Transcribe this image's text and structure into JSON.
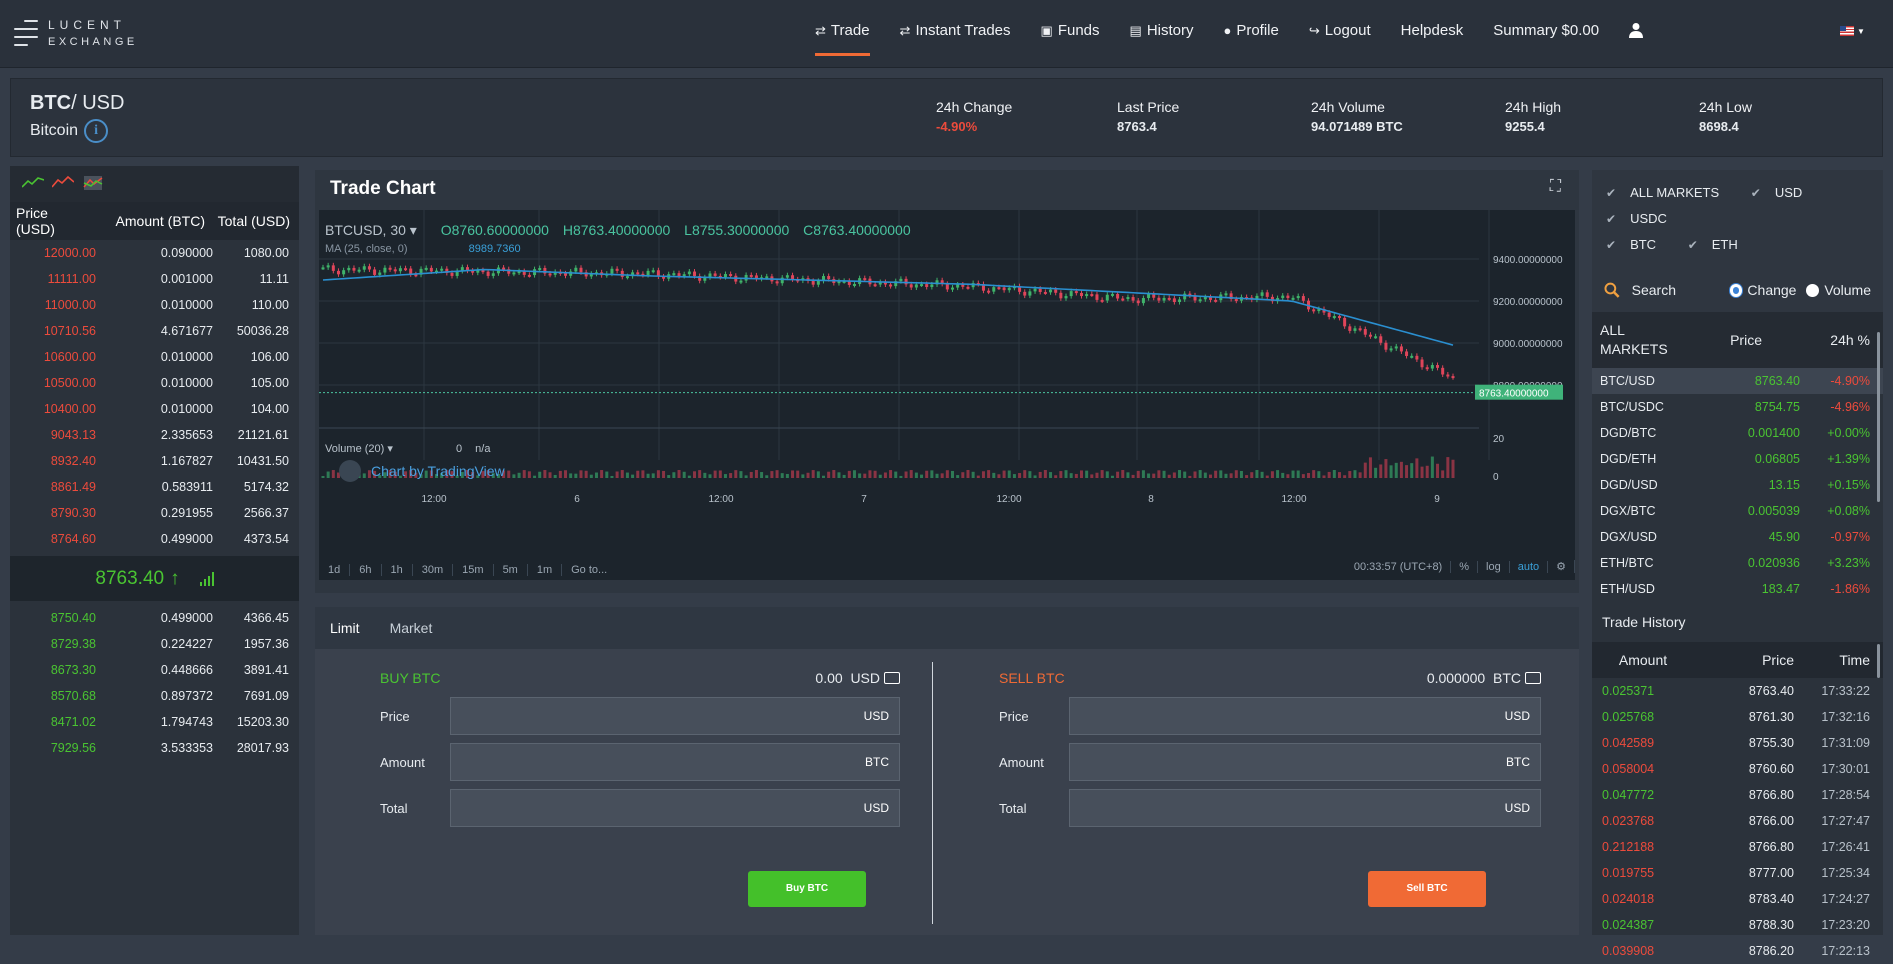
{
  "header": {
    "logo_line1": "LUCENT",
    "logo_line2": "EXCHANGE",
    "nav": [
      {
        "label": "Trade",
        "icon": "exchange-icon"
      },
      {
        "label": "Instant Trades",
        "icon": "exchange-icon"
      },
      {
        "label": "Funds",
        "icon": "money-icon"
      },
      {
        "label": "History",
        "icon": "book-icon"
      },
      {
        "label": "Profile",
        "icon": "user-icon"
      },
      {
        "label": "Logout",
        "icon": "logout-icon"
      },
      {
        "label": "Helpdesk"
      },
      {
        "label": "Summary $0.00"
      }
    ]
  },
  "ticker": {
    "base": "BTC",
    "quote": "/ USD",
    "name": "Bitcoin",
    "stats": [
      {
        "label": "24h Change",
        "value": "-4.90%"
      },
      {
        "label": "Last Price",
        "value": "8763.4"
      },
      {
        "label": "24h Volume",
        "value": "94.071489 BTC"
      },
      {
        "label": "24h High",
        "value": "9255.4"
      },
      {
        "label": "24h Low",
        "value": "8698.4"
      }
    ]
  },
  "orderbook": {
    "cols": [
      "Price (USD)",
      "Amount (BTC)",
      "Total (USD)"
    ],
    "asks": [
      [
        "12000.00",
        "0.090000",
        "1080.00"
      ],
      [
        "11111.00",
        "0.001000",
        "11.11"
      ],
      [
        "11000.00",
        "0.010000",
        "110.00"
      ],
      [
        "10710.56",
        "4.671677",
        "50036.28"
      ],
      [
        "10600.00",
        "0.010000",
        "106.00"
      ],
      [
        "10500.00",
        "0.010000",
        "105.00"
      ],
      [
        "10400.00",
        "0.010000",
        "104.00"
      ],
      [
        "9043.13",
        "2.335653",
        "21121.61"
      ],
      [
        "8932.40",
        "1.167827",
        "10431.50"
      ],
      [
        "8861.49",
        "0.583911",
        "5174.32"
      ],
      [
        "8790.30",
        "0.291955",
        "2566.37"
      ],
      [
        "8764.60",
        "0.499000",
        "4373.54"
      ]
    ],
    "last": "8763.40",
    "bids": [
      [
        "8750.40",
        "0.499000",
        "4366.45"
      ],
      [
        "8729.38",
        "0.224227",
        "1957.36"
      ],
      [
        "8673.30",
        "0.448666",
        "3891.41"
      ],
      [
        "8570.68",
        "0.897372",
        "7691.09"
      ],
      [
        "8471.02",
        "1.794743",
        "15203.30"
      ],
      [
        "7929.56",
        "3.533353",
        "28017.93"
      ]
    ]
  },
  "chart": {
    "title": "Trade Chart",
    "symbol": "BTCUSD, 30",
    "o": "O8760.60000000",
    "h": "H8763.40000000",
    "l": "L8755.30000000",
    "c": "C8763.40000000",
    "ma_label": "MA (25, close, 0)",
    "ma_value": "8989.7360",
    "volume_label": "Volume (20)",
    "volume_value": "0",
    "volume_na": "n/a",
    "tv_label": "Chart by TradingView",
    "price_ticks": [
      "9400.00000000",
      "9200.00000000",
      "9000.00000000",
      "8800.00000000"
    ],
    "current_price": "8763.40000000",
    "vol_ticks": [
      "20",
      "0"
    ],
    "time_ticks": [
      "12:00",
      "6",
      "12:00",
      "7",
      "12:00",
      "8",
      "12:00",
      "9"
    ],
    "timeframes": [
      "1d",
      "6h",
      "1h",
      "30m",
      "15m",
      "5m",
      "1m",
      "Go to..."
    ],
    "clock": "00:33:57 (UTC+8)",
    "opts": [
      "%",
      "log",
      "auto"
    ]
  },
  "chart_data": {
    "type": "line",
    "title": "Trade Chart",
    "xlabel": "",
    "ylabel": "",
    "x": [
      "12:00",
      "6",
      "12:00",
      "7",
      "12:00",
      "8",
      "12:00",
      "9"
    ],
    "series": [
      {
        "name": "BTCUSD, 30",
        "values": [
          9350,
          9340,
          9330,
          9300,
          9270,
          9210,
          9220,
          8830
        ]
      },
      {
        "name": "MA (25, close, 0)",
        "values": [
          9300,
          9350,
          9320,
          9300,
          9280,
          9240,
          9200,
          8990
        ]
      }
    ],
    "ylim": [
      8700,
      9500
    ]
  },
  "order": {
    "tabs": [
      "Limit",
      "Market"
    ],
    "buy": {
      "title": "BUY BTC",
      "balance": "0.00",
      "unit": "USD",
      "fields": [
        [
          "Price",
          "USD"
        ],
        [
          "Amount",
          "BTC"
        ],
        [
          "Total",
          "USD"
        ]
      ],
      "button": "Buy BTC",
      "color": "#4ac432"
    },
    "sell": {
      "title": "SELL BTC",
      "balance": "0.000000",
      "unit": "BTC",
      "fields": [
        [
          "Price",
          "USD"
        ],
        [
          "Amount",
          "BTC"
        ],
        [
          "Total",
          "USD"
        ]
      ],
      "button": "Sell BTC",
      "color": "#f06a35"
    }
  },
  "markets": {
    "filters": [
      "ALL MARKETS",
      "USD",
      "USDC",
      "BTC",
      "ETH"
    ],
    "search": "Search",
    "sort_change": "Change",
    "sort_volume": "Volume",
    "head": [
      "ALL MARKETS",
      "Price",
      "24h %"
    ],
    "rows": [
      [
        "BTC/USD",
        "8763.40",
        "-4.90%"
      ],
      [
        "BTC/USDC",
        "8754.75",
        "-4.96%"
      ],
      [
        "DGD/BTC",
        "0.001400",
        "+0.00%"
      ],
      [
        "DGD/ETH",
        "0.06805",
        "+1.39%"
      ],
      [
        "DGD/USD",
        "13.15",
        "+0.15%"
      ],
      [
        "DGX/BTC",
        "0.005039",
        "+0.08%"
      ],
      [
        "DGX/USD",
        "45.90",
        "-0.97%"
      ],
      [
        "ETH/BTC",
        "0.020936",
        "+3.23%"
      ],
      [
        "ETH/USD",
        "183.47",
        "-1.86%"
      ]
    ]
  },
  "trade_history": {
    "title": "Trade History",
    "head": [
      "Amount",
      "Price",
      "Time"
    ],
    "rows": [
      [
        "0.025371",
        "8763.40",
        "17:33:22",
        "g"
      ],
      [
        "0.025768",
        "8761.30",
        "17:32:16",
        "g"
      ],
      [
        "0.042589",
        "8755.30",
        "17:31:09",
        "r"
      ],
      [
        "0.058004",
        "8760.60",
        "17:30:01",
        "r"
      ],
      [
        "0.047772",
        "8766.80",
        "17:28:54",
        "g"
      ],
      [
        "0.023768",
        "8766.00",
        "17:27:47",
        "r"
      ],
      [
        "0.212188",
        "8766.80",
        "17:26:41",
        "r"
      ],
      [
        "0.019755",
        "8777.00",
        "17:25:34",
        "r"
      ],
      [
        "0.024018",
        "8783.40",
        "17:24:27",
        "r"
      ],
      [
        "0.024387",
        "8788.30",
        "17:23:20",
        "g"
      ],
      [
        "0.039908",
        "8786.20",
        "17:22:13",
        "r"
      ]
    ]
  }
}
